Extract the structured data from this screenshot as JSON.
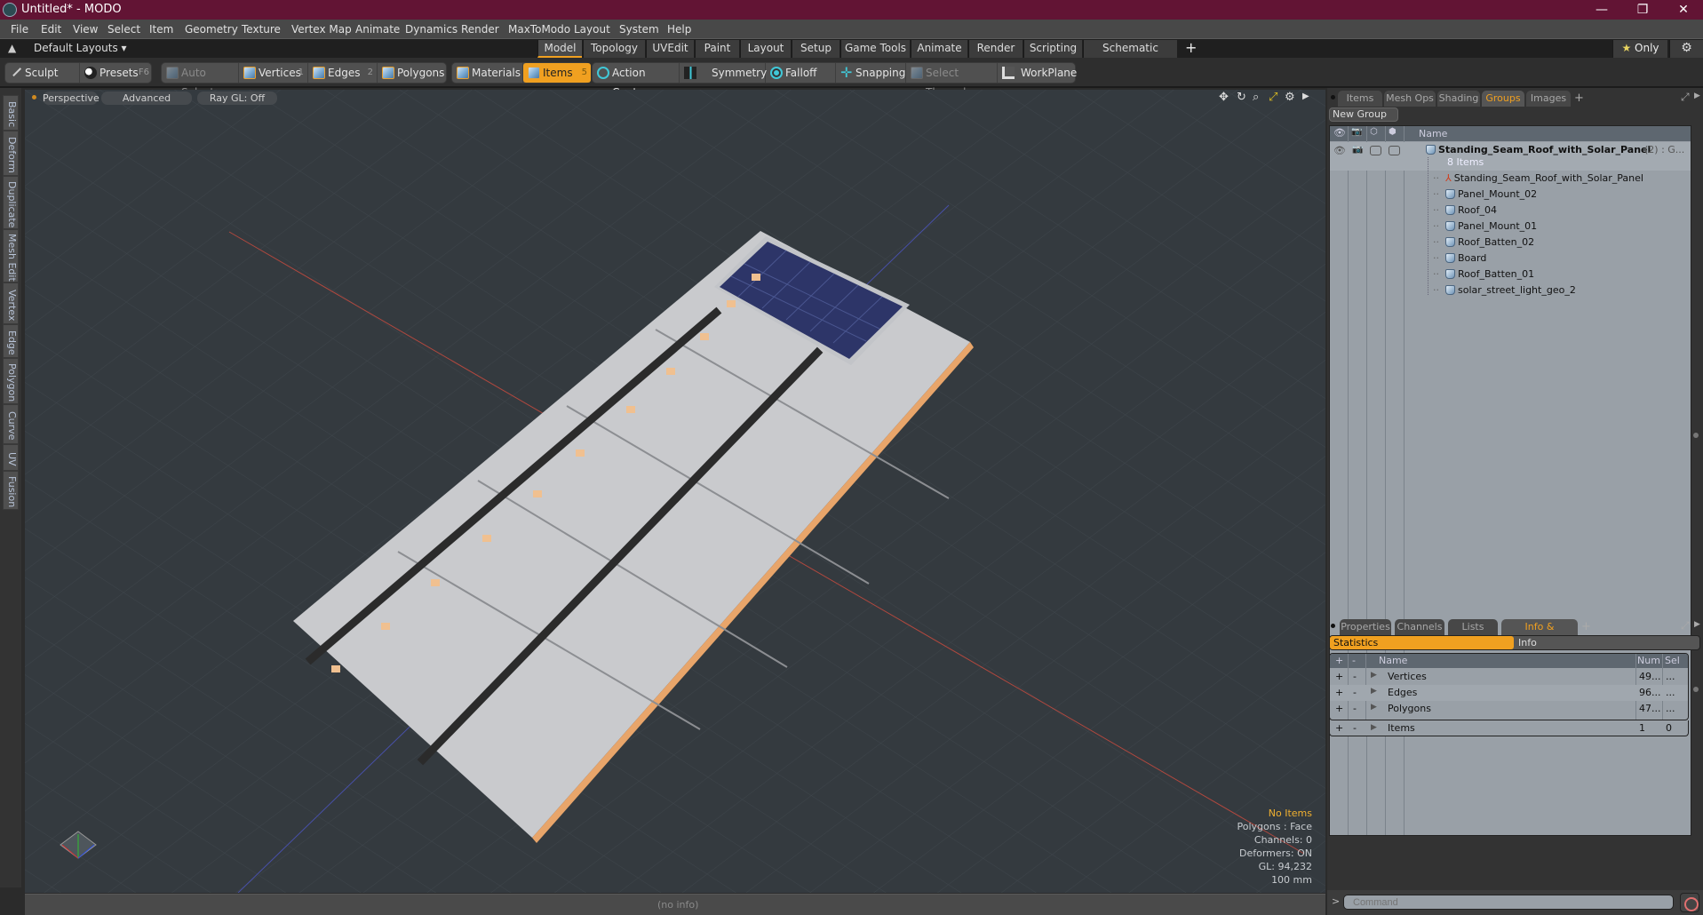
{
  "window": {
    "title": "Untitled* - MODO",
    "controls": {
      "minimize": "—",
      "restore": "❐",
      "close": "✕"
    }
  },
  "menu": [
    "File",
    "Edit",
    "View",
    "Select",
    "Item",
    "Geometry",
    "Texture",
    "Vertex Map",
    "Animate",
    "Dynamics",
    "Render",
    "MaxToModo",
    "Layout",
    "System",
    "Help"
  ],
  "layoutbar": {
    "default_layouts": "Default Layouts ▾",
    "tabs": [
      "Model",
      "Topology",
      "UVEdit",
      "Paint",
      "Layout",
      "Setup",
      "Game Tools",
      "Animate",
      "Render",
      "Scripting",
      "Schematic Fusion"
    ],
    "active_tab": "Model",
    "add": "+",
    "only_label": "★ Only"
  },
  "toolbar": {
    "sculpt": "Sculpt",
    "presets": "Presets",
    "presets_key": "F6",
    "auto_select": "Auto Select",
    "vertices": "Vertices",
    "vertices_key": "1",
    "edges": "Edges",
    "edges_key": "2",
    "polygons": "Polygons",
    "materials": "Materials",
    "items": "Items",
    "items_key": "5",
    "action_center": "Action Center",
    "symmetry": "Symmetry",
    "falloff": "Falloff",
    "snapping": "Snapping",
    "select_through": "Select Through",
    "workplane": "WorkPlane"
  },
  "left_tabs": [
    "Basic",
    "Deform",
    "Duplicate",
    "Mesh Edit",
    "Vertex",
    "Edge",
    "Polygon",
    "Curve",
    "UV",
    "Fusion"
  ],
  "viewport": {
    "view_mode": "Perspective",
    "shading": "Advanced",
    "raygl": "Ray GL: Off",
    "info": {
      "selection": "No Items",
      "polygons": "Polygons : Face",
      "channels": "Channels: 0",
      "deformers": "Deformers: ON",
      "gl": "GL: 94,232",
      "unit": "100 mm"
    }
  },
  "statusbar": {
    "text": "(no info)"
  },
  "right_panel": {
    "tabs": [
      "Items",
      "Mesh Ops",
      "Shading",
      "Groups",
      "Images"
    ],
    "active_tab": "Groups",
    "new_group": "New Group",
    "name_header": "Name",
    "group": {
      "name": "Standing_Seam_Roof_with_Solar_Panel",
      "suffix": "(2) : G...",
      "count": "8 Items"
    },
    "items": [
      {
        "name": "Standing_Seam_Roof_with_Solar_Panel",
        "type": "locator"
      },
      {
        "name": "Panel_Mount_02",
        "type": "mesh"
      },
      {
        "name": "Roof_04",
        "type": "mesh"
      },
      {
        "name": "Panel_Mount_01",
        "type": "mesh"
      },
      {
        "name": "Roof_Batten_02",
        "type": "mesh"
      },
      {
        "name": "Board",
        "type": "mesh"
      },
      {
        "name": "Roof_Batten_01",
        "type": "mesh"
      },
      {
        "name": "solar_street_light_geo_2",
        "type": "mesh"
      }
    ]
  },
  "bottom_panel": {
    "tabs": [
      "Properties",
      "Channels",
      "Lists",
      "Info & Statistics"
    ],
    "active_tab": "Info & Statistics",
    "stats_tab": "Statistics",
    "info_tab": "Info",
    "headers": {
      "plus": "+",
      "minus": "-",
      "name": "Name",
      "num": "Num",
      "sel": "Sel"
    },
    "rows": [
      {
        "name": "Vertices",
        "num": "49...",
        "sel": "..."
      },
      {
        "name": "Edges",
        "num": "96...",
        "sel": "..."
      },
      {
        "name": "Polygons",
        "num": "47...",
        "sel": "..."
      },
      {
        "name": "Items",
        "num": "1",
        "sel": "0"
      }
    ],
    "command_placeholder": "Command",
    "prompt": ">"
  },
  "colors": {
    "accent": "#f0a020",
    "titlebar": "#621434",
    "viewport": "#343a3f"
  }
}
